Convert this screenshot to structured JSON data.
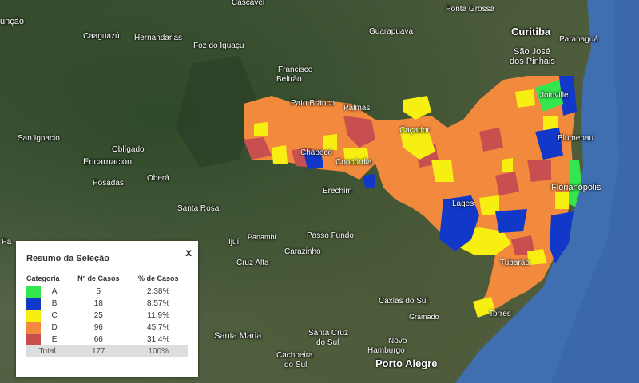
{
  "map": {
    "places": [
      {
        "name": "Cascavel"
      },
      {
        "name": "unção"
      },
      {
        "name": "Ponta Grossa"
      },
      {
        "name": "Caaguazú"
      },
      {
        "name": "Hernandarias"
      },
      {
        "name": "Foz do Iguaçu"
      },
      {
        "name": "Guarapuava"
      },
      {
        "name": "Curitiba"
      },
      {
        "name": "São José"
      },
      {
        "name": "dos Pinhais"
      },
      {
        "name": "Paranaguá"
      },
      {
        "name": "Francisco"
      },
      {
        "name": "Beltrão"
      },
      {
        "name": "Pato Branco"
      },
      {
        "name": "Palmas"
      },
      {
        "name": "Joinville"
      },
      {
        "name": "San Ignacio"
      },
      {
        "name": "Oblígado"
      },
      {
        "name": "Chapecó"
      },
      {
        "name": "Caçador"
      },
      {
        "name": "Blumenau"
      },
      {
        "name": "Encarnación"
      },
      {
        "name": "Concórdia"
      },
      {
        "name": "Posadas"
      },
      {
        "name": "Oberá"
      },
      {
        "name": "Erechim"
      },
      {
        "name": "Florianópolis"
      },
      {
        "name": "Lages"
      },
      {
        "name": "Santa Rosa"
      },
      {
        "name": "Passo Fundo"
      },
      {
        "name": "Ijuí"
      },
      {
        "name": "Panambi"
      },
      {
        "name": "Cruz Alta"
      },
      {
        "name": "Carazinho"
      },
      {
        "name": "Tubarão"
      },
      {
        "name": "Caxias do Sul"
      },
      {
        "name": "Gramado"
      },
      {
        "name": "Santa Maria"
      },
      {
        "name": "Santa Cruz"
      },
      {
        "name": "do Sul"
      },
      {
        "name": "Torres"
      },
      {
        "name": "Cachoeira"
      },
      {
        "name": "do Sul"
      },
      {
        "name": "Novo"
      },
      {
        "name": "Hamburgo"
      },
      {
        "name": "Porto Alegre"
      },
      {
        "name": "Pa"
      }
    ]
  },
  "panel": {
    "title": "Resumo da Seleção",
    "close_label": "x",
    "headers": [
      "Categoria",
      "Nº de Casos",
      "% de Casos"
    ],
    "rows": [
      {
        "category": "A",
        "cases": "5",
        "percent": "2.38%",
        "color": "#33e64d"
      },
      {
        "category": "B",
        "cases": "18",
        "percent": "8.57%",
        "color": "#1138c9"
      },
      {
        "category": "C",
        "cases": "25",
        "percent": "11.9%",
        "color": "#f7ee12"
      },
      {
        "category": "D",
        "cases": "96",
        "percent": "45.7%",
        "color": "#f28a3e"
      },
      {
        "category": "E",
        "cases": "66",
        "percent": "31.4%",
        "color": "#c84f4f"
      }
    ],
    "total": {
      "label": "Total",
      "cases": "177",
      "percent": "100%"
    }
  }
}
